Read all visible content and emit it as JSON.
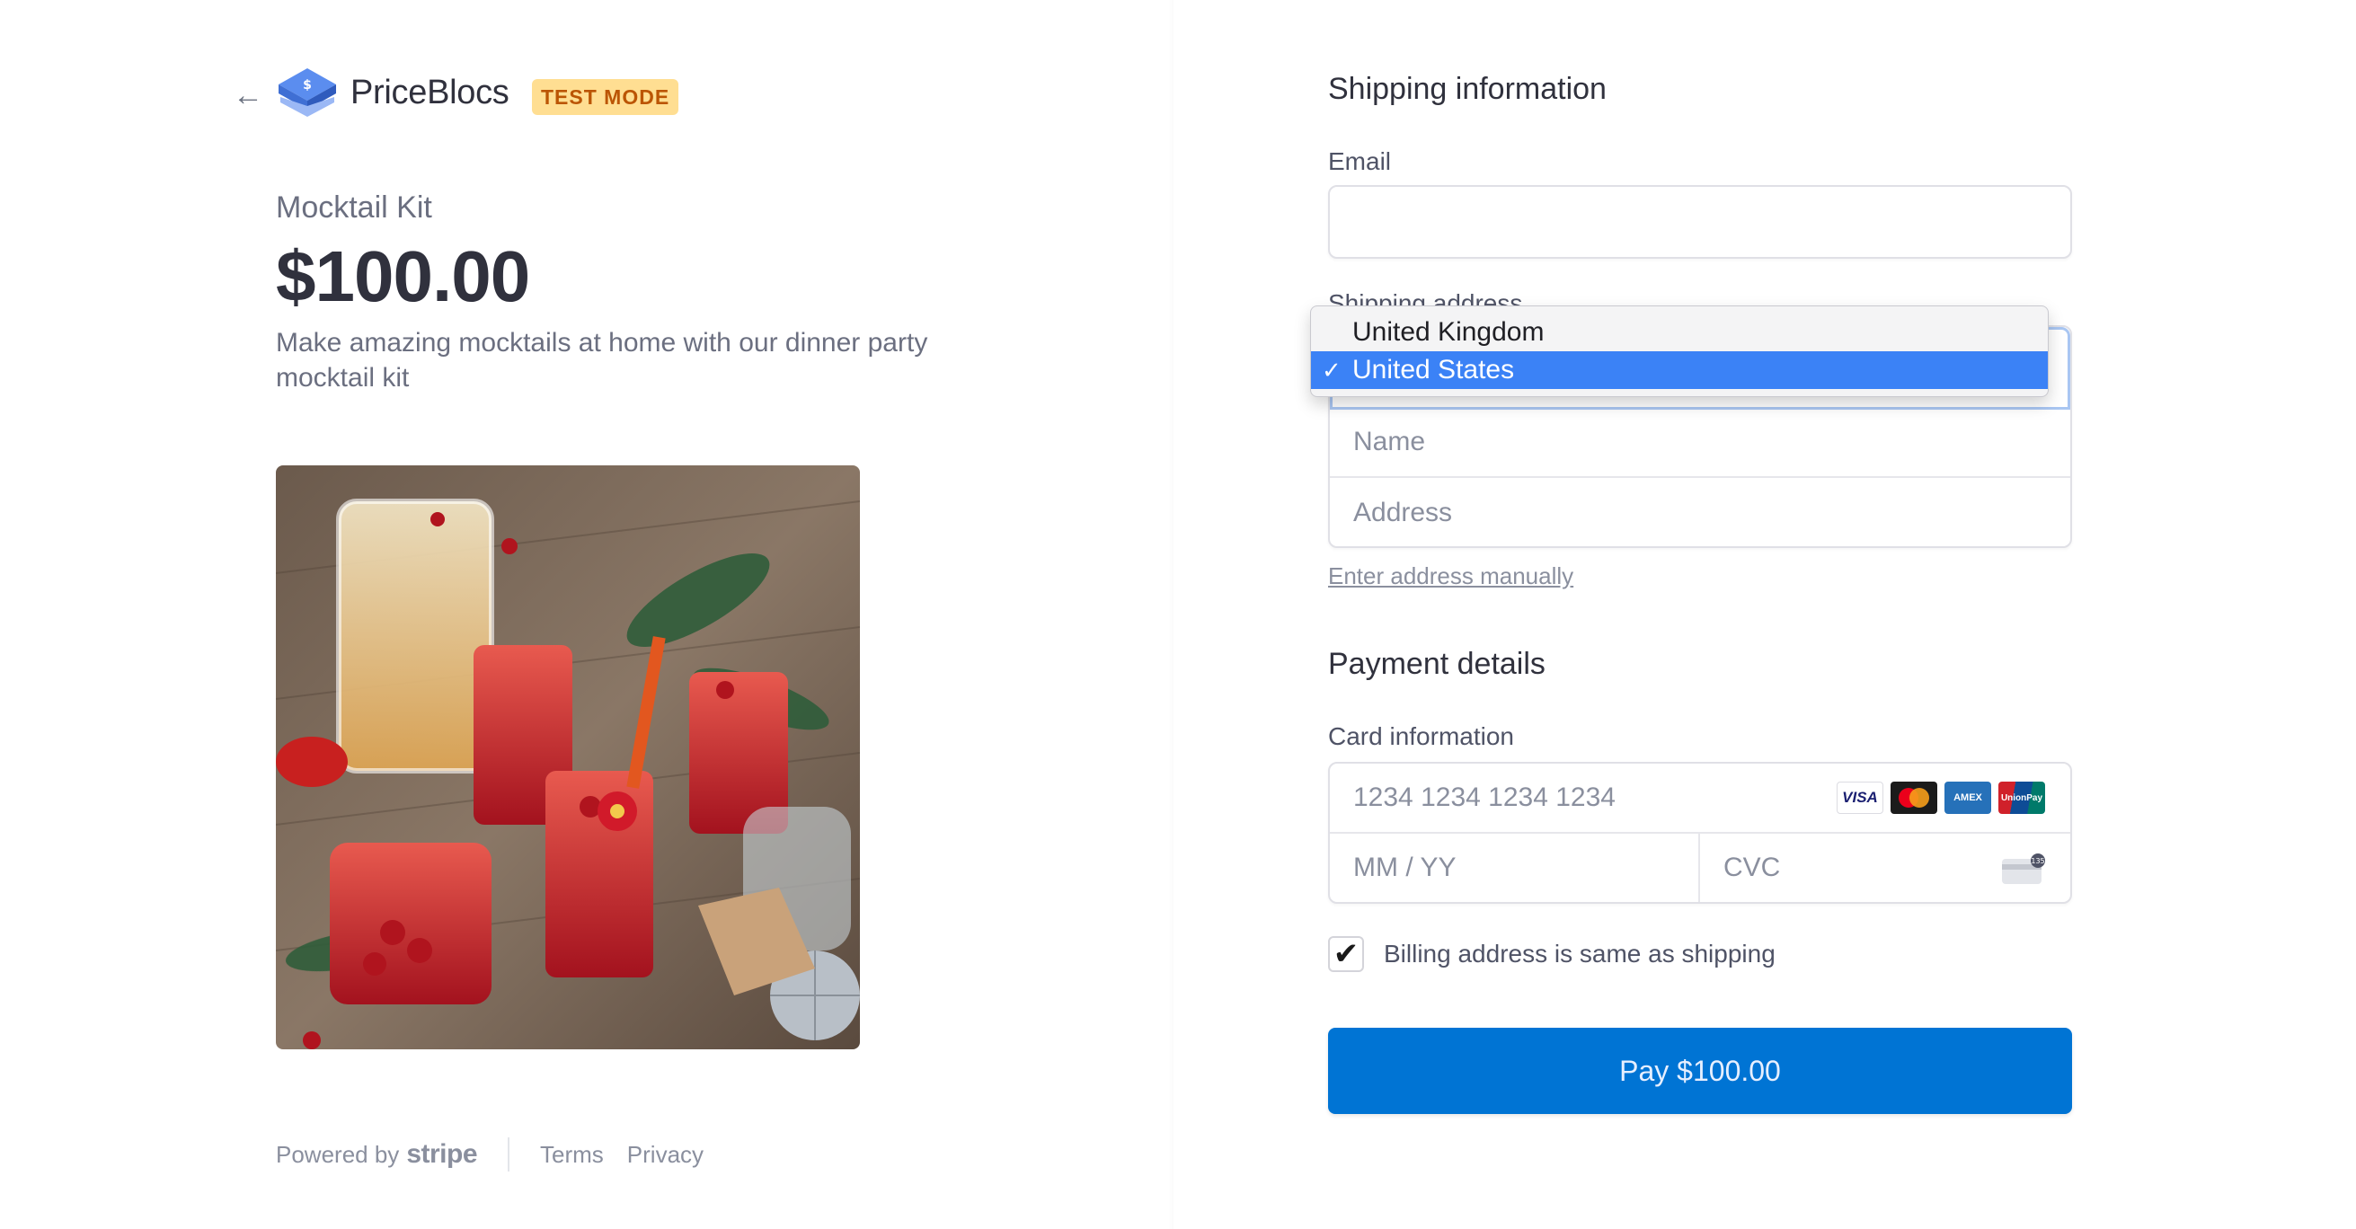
{
  "header": {
    "brand": "PriceBlocs",
    "badge": "TEST MODE"
  },
  "product": {
    "name": "Mocktail Kit",
    "price": "$100.00",
    "description": "Make amazing mocktails at home with our dinner party mocktail kit",
    "image_icon": "mocktail-photo"
  },
  "footer": {
    "powered_by": "Powered by",
    "stripe": "stripe",
    "terms": "Terms",
    "privacy": "Privacy"
  },
  "shipping": {
    "title": "Shipping information",
    "email_label": "Email",
    "address_label": "Shipping address",
    "country_options": [
      "United Kingdom",
      "United States"
    ],
    "selected_country": "United States",
    "check_mark": "✓",
    "name_placeholder": "Name",
    "address_placeholder": "Address",
    "manual_link": "Enter address manually"
  },
  "payment": {
    "title": "Payment details",
    "card_label": "Card information",
    "card_number_placeholder": "1234 1234 1234 1234",
    "expiry_placeholder": "MM / YY",
    "cvc_placeholder": "CVC",
    "brands": [
      "VISA",
      "",
      "AMEX",
      "UnionPay"
    ],
    "billing_same_label": "Billing address is same as shipping",
    "billing_checked": "✔",
    "pay_label": "Pay $100.00",
    "cvc_hint": "135"
  },
  "colors": {
    "pay_button": "#0074d4",
    "badge_bg": "#ffde92",
    "badge_text": "#bb5504",
    "dropdown_selected": "#3b82f6"
  }
}
